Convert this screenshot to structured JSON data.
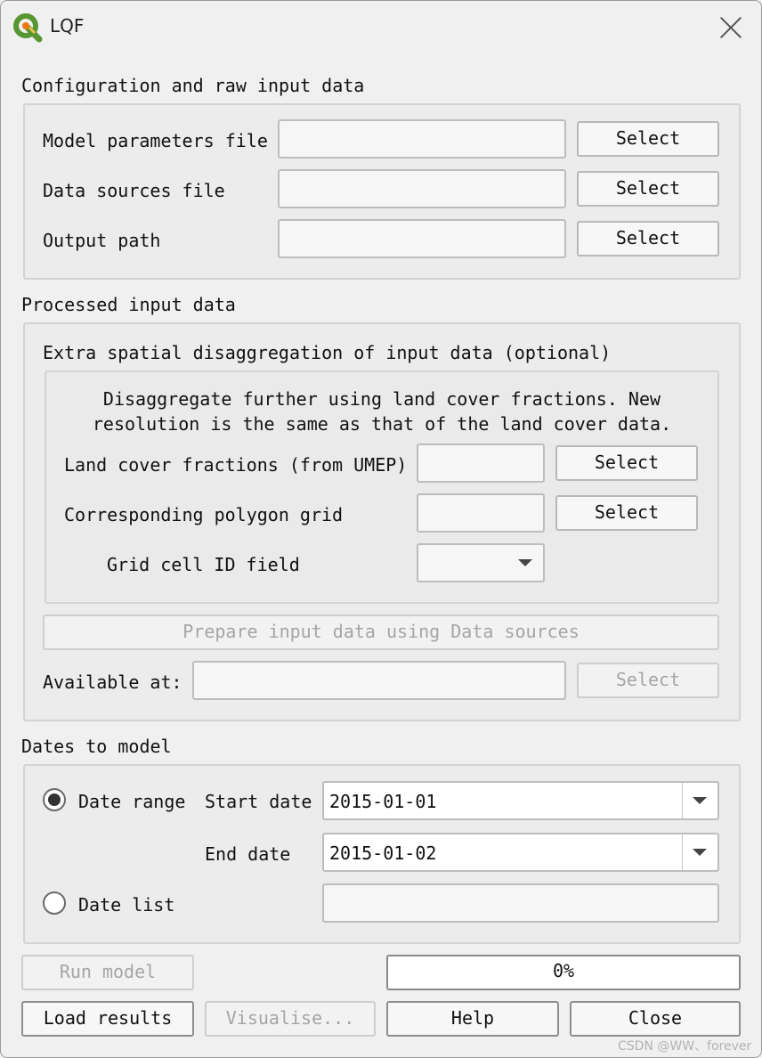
{
  "window": {
    "title": "LQF",
    "icon": "qgis-icon",
    "close_icon": "close-icon"
  },
  "config_section": {
    "heading": "Configuration and raw input data",
    "rows": [
      {
        "label": "Model parameters file",
        "value": "",
        "button": "Select"
      },
      {
        "label": "Data sources file",
        "value": "",
        "button": "Select"
      },
      {
        "label": "Output path",
        "value": "",
        "button": "Select"
      }
    ]
  },
  "processed_section": {
    "heading": "Processed input data",
    "sub_heading": "Extra spatial disaggregation of input data (optional)",
    "description_line1": "Disaggregate further using land cover fractions. New",
    "description_line2": "resolution is the same as that of the land cover data.",
    "land_cover_label": "Land cover fractions (from UMEP)",
    "land_cover_button": "Select",
    "polygon_grid_label": "Corresponding polygon grid",
    "polygon_grid_button": "Select",
    "grid_cell_label": "Grid cell ID field",
    "grid_cell_value": "",
    "prepare_button": "Prepare input data using Data sources",
    "available_label": "Available at:",
    "available_value": "",
    "available_button": "Select"
  },
  "dates_section": {
    "heading": "Dates to model",
    "date_range_label": "Date range",
    "date_range_selected": true,
    "start_date_label": "Start date",
    "start_date_value": "2015-01-01",
    "end_date_label": "End date",
    "end_date_value": "2015-01-02",
    "date_list_label": "Date list",
    "date_list_selected": false,
    "date_list_value": ""
  },
  "footer": {
    "run_model_button": "Run model",
    "progress_text": "0%",
    "progress_value": 0,
    "load_results_button": "Load results",
    "visualise_button": "Visualise...",
    "help_button": "Help",
    "close_button": "Close"
  },
  "watermark": "CSDN @WW、forever"
}
